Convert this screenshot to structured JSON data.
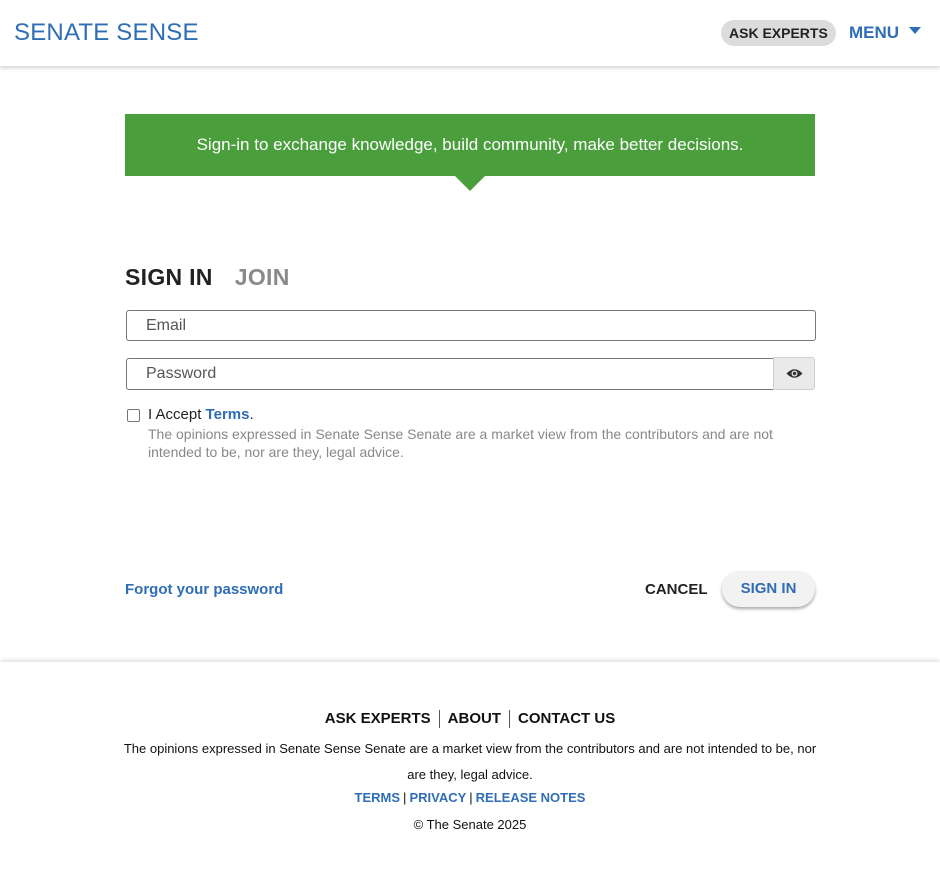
{
  "header": {
    "logo": "SENATE SENSE",
    "ask_experts": "ASK EXPERTS",
    "menu": "MENU"
  },
  "banner": {
    "text": "Sign-in to exchange knowledge, build community, make better decisions."
  },
  "auth": {
    "tabs": [
      "SIGN IN",
      "JOIN"
    ],
    "active_tab": "SIGN IN",
    "email_placeholder": "Email",
    "password_placeholder": "Password",
    "accept_prefix": "I Accept ",
    "terms_link": "Terms",
    "accept_suffix": ".",
    "disclaimer": "The opinions expressed in Senate Sense Senate are a market view from the contributors and are not intended to be, nor are they, legal advice.",
    "forgot": "Forgot your password",
    "cancel": "CANCEL",
    "submit": "SIGN IN"
  },
  "footer": {
    "links": [
      "ASK EXPERTS",
      "ABOUT",
      "CONTACT US"
    ],
    "disclaimer": "The opinions expressed in Senate Sense Senate are a market view from the contributors and are not intended to be, nor are they, legal advice.",
    "legal": [
      "TERMS",
      "PRIVACY",
      "RELEASE NOTES"
    ],
    "copyright": "© The Senate 2025"
  },
  "colors": {
    "brand": "#2f6db5",
    "banner": "#4a9e3c"
  },
  "icons": {
    "show_password": "eye-icon",
    "menu_caret": "caret-down-icon"
  }
}
